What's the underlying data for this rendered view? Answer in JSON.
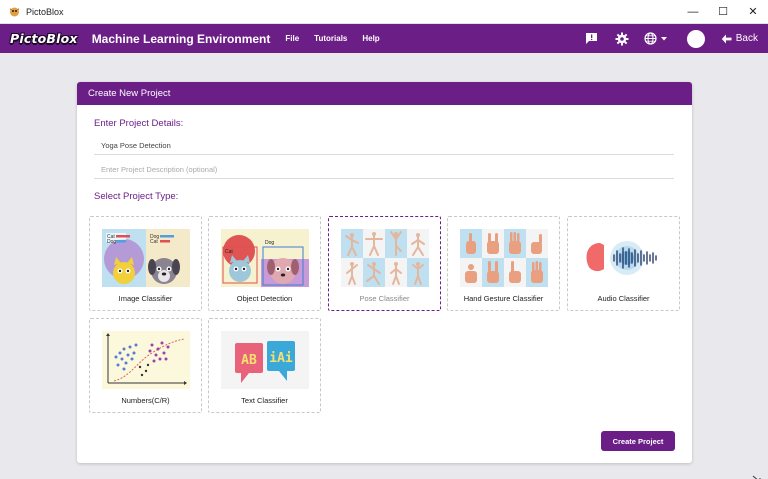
{
  "os": {
    "title": "PictoBlox",
    "minimize": "—",
    "maximize": "☐",
    "close": "✕"
  },
  "header": {
    "logo": "PictoBlox",
    "title": "Machine Learning Environment",
    "menu": [
      "File",
      "Tutorials",
      "Help"
    ],
    "back_label": "Back"
  },
  "panel": {
    "title": "Create New Project",
    "details_label": "Enter Project Details:",
    "name_value": "Yoga Pose Detection",
    "description_placeholder": "Enter Project Description (optional)",
    "type_label": "Select Project Type:",
    "create_button": "Create Project"
  },
  "project_types": [
    {
      "label": "Image Classifier",
      "selected": false,
      "thumb_text": [
        "Cat",
        "Dog",
        "Dog",
        "Cat"
      ]
    },
    {
      "label": "Object Detection",
      "selected": false,
      "thumb_text": [
        "Cat",
        "Dog"
      ]
    },
    {
      "label": "Pose Classifier",
      "selected": true
    },
    {
      "label": "Hand Gesture Classifier",
      "selected": false
    },
    {
      "label": "Audio Classifier",
      "selected": false
    },
    {
      "label": "Numbers(C/R)",
      "selected": false
    },
    {
      "label": "Text Classifier",
      "selected": false,
      "thumb_text": [
        "AB",
        "iAi"
      ]
    }
  ],
  "colors": {
    "brand": "#6c1e87",
    "background": "#e9e9ed"
  }
}
